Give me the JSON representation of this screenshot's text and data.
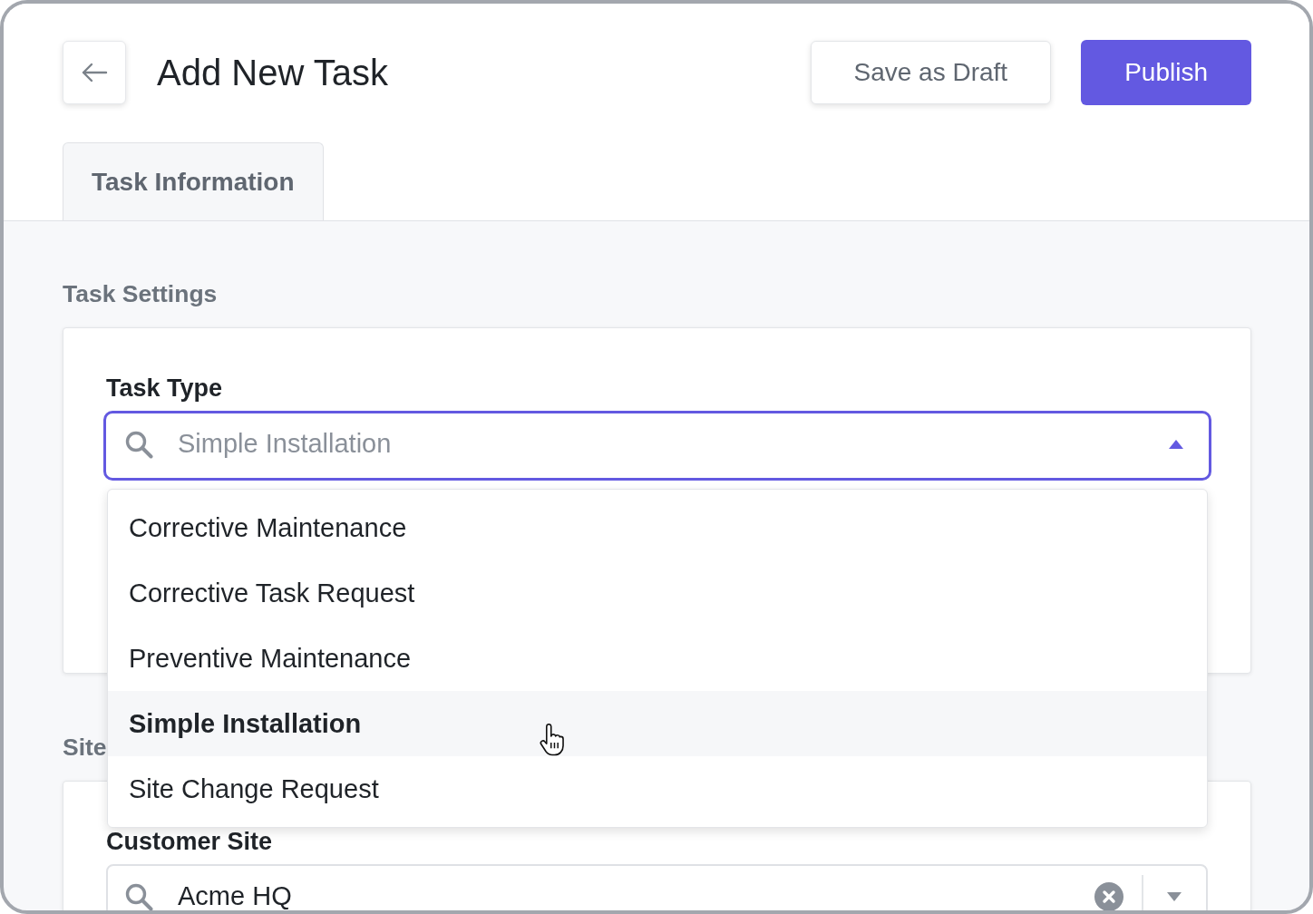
{
  "header": {
    "title": "Add New Task",
    "actions": [
      {
        "label": "Save as Draft",
        "kind": "secondary"
      },
      {
        "label": "Publish",
        "kind": "primary"
      }
    ]
  },
  "tabs": [
    {
      "label": "Task Information",
      "selected": true
    }
  ],
  "sections": [
    {
      "title": "Task Settings",
      "fields": [
        {
          "label": "Task Type",
          "placeholder": "Simple Installation",
          "expanded": true,
          "options": [
            {
              "label": "Corrective Maintenance",
              "selected": false
            },
            {
              "label": "Corrective Task Request",
              "selected": false
            },
            {
              "label": "Preventive Maintenance",
              "selected": false
            },
            {
              "label": "Simple Installation",
              "selected": true
            },
            {
              "label": "Site Change Request",
              "selected": false
            }
          ]
        }
      ]
    },
    {
      "title": "Site",
      "fields": [
        {
          "label": "Customer Site",
          "value": "Acme HQ",
          "expanded": false
        }
      ]
    }
  ]
}
